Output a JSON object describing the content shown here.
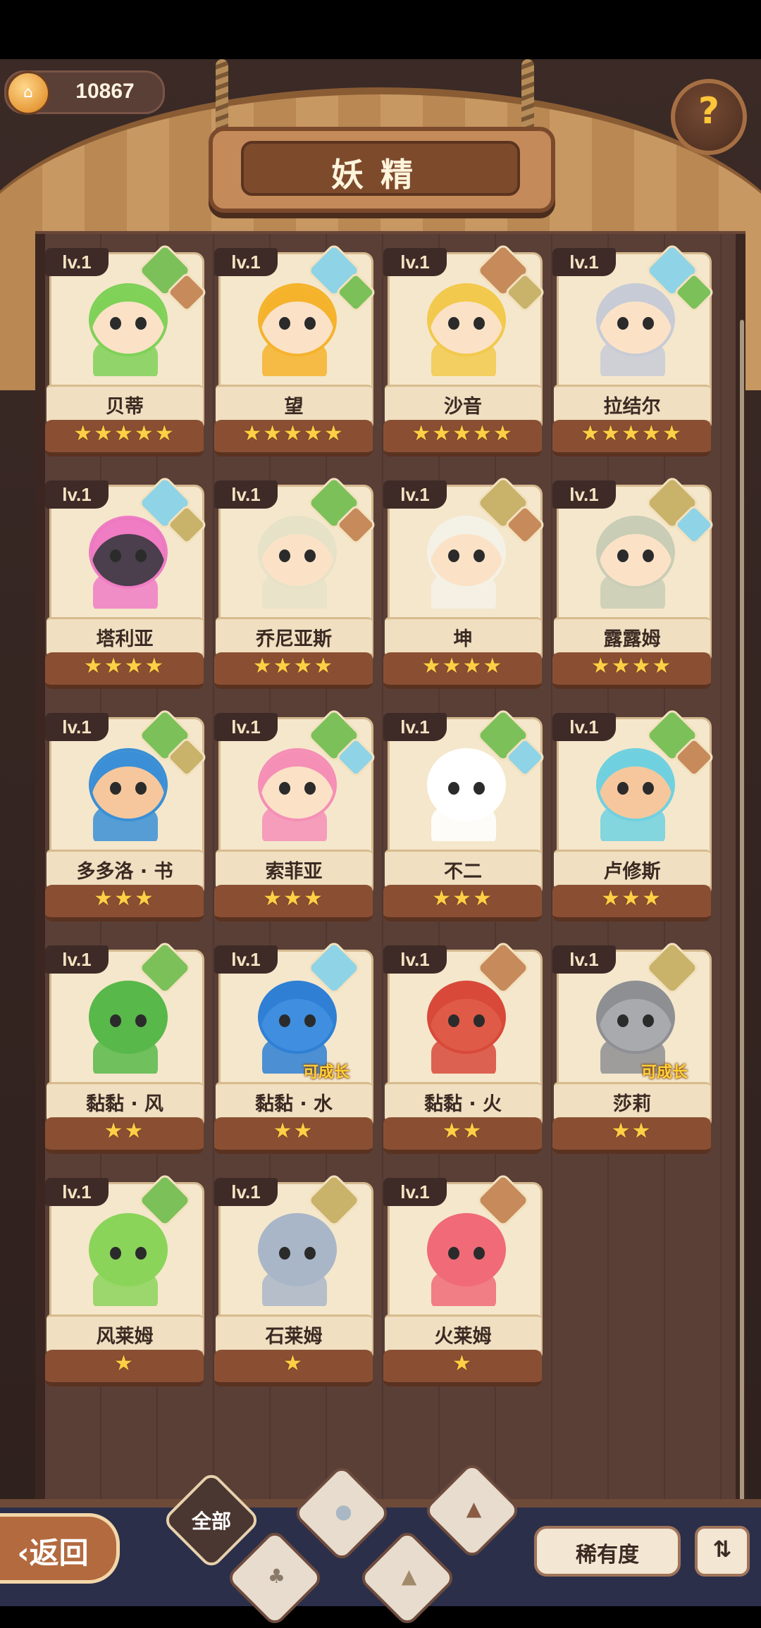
{
  "header": {
    "title": "妖精",
    "currency": {
      "value": "10867",
      "icon": "castle-coin-icon"
    },
    "help_icon": "question-sprout-icon"
  },
  "cards": [
    {
      "level": "lv.1",
      "name": "贝蒂",
      "stars": "★★★★★",
      "hair": "#7fd158",
      "skin": "#fbe2c6",
      "elements": [
        "#7cc05a",
        "#c78a5a"
      ]
    },
    {
      "level": "lv.1",
      "name": "望",
      "stars": "★★★★★",
      "hair": "#f5b32c",
      "skin": "#fbe2c6",
      "elements": [
        "#8fd3e6",
        "#7cc05a"
      ]
    },
    {
      "level": "lv.1",
      "name": "沙音",
      "stars": "★★★★★",
      "hair": "#f2c94c",
      "skin": "#fbe2c6",
      "elements": [
        "#c78a5a",
        "#c9b26a"
      ]
    },
    {
      "level": "lv.1",
      "name": "拉结尔",
      "stars": "★★★★★",
      "hair": "#c7cbd6",
      "skin": "#fbe2c6",
      "elements": [
        "#8fd3e6",
        "#7cc05a"
      ]
    },
    {
      "level": "lv.1",
      "name": "塔利亚",
      "stars": "★★★★",
      "hair": "#f07cc4",
      "skin": "#4b3e4d",
      "elements": [
        "#8fd3e6",
        "#c9b26a"
      ]
    },
    {
      "level": "lv.1",
      "name": "乔尼亚斯",
      "stars": "★★★★",
      "hair": "#e6e2c8",
      "skin": "#fbe2c6",
      "elements": [
        "#7cc05a",
        "#c78a5a"
      ]
    },
    {
      "level": "lv.1",
      "name": "坤",
      "stars": "★★★★",
      "hair": "#f4f1e6",
      "skin": "#fbe2c6",
      "elements": [
        "#c9b26a",
        "#c78a5a"
      ]
    },
    {
      "level": "lv.1",
      "name": "露露姆",
      "stars": "★★★★",
      "hair": "#c9cdb5",
      "skin": "#fbe2c6",
      "elements": [
        "#c9b26a",
        "#8fd3e6"
      ]
    },
    {
      "level": "lv.1",
      "name": "多多洛 · 书",
      "stars": "★★★",
      "hair": "#3a8fd6",
      "skin": "#f6c79d",
      "elements": [
        "#7cc05a",
        "#c9b26a"
      ]
    },
    {
      "level": "lv.1",
      "name": "索菲亚",
      "stars": "★★★",
      "hair": "#f58fb6",
      "skin": "#fbe2c6",
      "elements": [
        "#7cc05a",
        "#8fd3e6"
      ]
    },
    {
      "level": "lv.1",
      "name": "不二",
      "stars": "★★★",
      "hair": "#ffffff",
      "skin": "#ffffff",
      "elements": [
        "#7cc05a",
        "#8fd3e6"
      ]
    },
    {
      "level": "lv.1",
      "name": "卢修斯",
      "stars": "★★★",
      "hair": "#6fd1e0",
      "skin": "#f6c79d",
      "elements": [
        "#7cc05a",
        "#c78a5a"
      ]
    },
    {
      "level": "lv.1",
      "name": "黏黏 · 风",
      "stars": "★★",
      "hair": "#58b84a",
      "skin": "#58b84a",
      "elements": [
        "#7cc05a"
      ],
      "growable": ""
    },
    {
      "level": "lv.1",
      "name": "黏黏 · 水",
      "stars": "★★",
      "hair": "#2f7fd4",
      "skin": "#3f8ee0",
      "elements": [
        "#8fd3e6"
      ],
      "growable": "可成长"
    },
    {
      "level": "lv.1",
      "name": "黏黏 · 火",
      "stars": "★★",
      "hair": "#d8493a",
      "skin": "#e05a48",
      "elements": [
        "#c78a5a"
      ],
      "growable": ""
    },
    {
      "level": "lv.1",
      "name": "莎莉",
      "stars": "★★",
      "hair": "#8e8f93",
      "skin": "#a9aaae",
      "elements": [
        "#c9b26a"
      ],
      "growable": "可成长"
    },
    {
      "level": "lv.1",
      "name": "风莱姆",
      "stars": "★",
      "hair": "#8bd45a",
      "skin": "#8bd45a",
      "elements": [
        "#7cc05a"
      ]
    },
    {
      "level": "lv.1",
      "name": "石莱姆",
      "stars": "★",
      "hair": "#a9b6c8",
      "skin": "#a9b6c8",
      "elements": [
        "#c9b26a"
      ]
    },
    {
      "level": "lv.1",
      "name": "火莱姆",
      "stars": "★",
      "hair": "#f06a78",
      "skin": "#f06a78",
      "elements": [
        "#c78a5a"
      ]
    }
  ],
  "bottom": {
    "back_label": "‹返回",
    "filter_all_label": "全部",
    "filters": [
      "plant-filter-icon",
      "water-filter-icon",
      "mountain-filter-icon",
      "earth-filter-icon"
    ],
    "sort_label": "稀有度",
    "order_icon": "sort-order-icon"
  }
}
